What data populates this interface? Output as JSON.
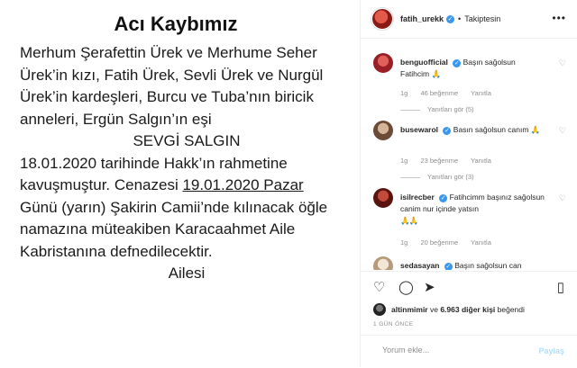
{
  "obituary": {
    "title": "Acı Kaybımız",
    "lines": [
      "Merhum Şerafettin Ürek ve Merhume Seher",
      "Ürek’in kızı, Fatih Ürek, Sevli Ürek ve Nurgül",
      "Ürek’in kardeşleri, Burcu ve Tuba’nın biricik",
      "anneleri, Ergün Salgın’ın eşi",
      "SEVGİ SALGIN",
      "18.01.2020 tarihinde Hakk’ın rahmetine",
      "kavuşmuştur. Cenazesi ",
      "19.01.2020 Pazar",
      "Günü (yarın) Şakirin Camii’nde kılınacak öğle",
      "namazına müteakiben Karacaahmet Aile",
      "Kabristanına defnedilecektir.",
      "Ailesi"
    ]
  },
  "header": {
    "username": "fatih_urekk",
    "verified": "✓",
    "separator": "•",
    "follow_status": "Takiptesin",
    "more": "•••"
  },
  "comments": [
    {
      "username": "benguofficial",
      "text": "Başın sağolsun Fatihcim",
      "emoji": "🙏",
      "time": "1g",
      "likes": "46 beğenme",
      "reply": "Yanıtla",
      "replies": "Yanıtları gör (5)"
    },
    {
      "username": "busewarol",
      "text": "Basın sağolsun canım",
      "emoji": "🙏",
      "time": "1g",
      "likes": "23 beğenme",
      "reply": "Yanıtla",
      "replies": "Yanıtları gör (3)"
    },
    {
      "username": "isilrecber",
      "text": "Fatihcimm başınız sağolsun canim nur içinde yatsın",
      "emoji": "🙏🙏",
      "time": "1g",
      "likes": "20 beğenme",
      "reply": "Yanıtla",
      "replies": ""
    },
    {
      "username": "sedasayan",
      "text": "Başın sağolsun can",
      "emoji": "",
      "time": "",
      "likes": "",
      "reply": "",
      "replies": ""
    }
  ],
  "icons": {
    "heart": "♡",
    "comment": "◯",
    "share": "➤",
    "bookmark": "▯"
  },
  "likes": {
    "user": "altinmimir",
    "connector": " ve ",
    "others": "6.963 diğer kişi",
    "suffix": " beğendi"
  },
  "timestamp": "1 GÜN ÖNCE",
  "add_comment": {
    "placeholder": "Yorum ekle...",
    "post_label": "Paylaş"
  },
  "colors": {
    "verified_blue": "#3897f0",
    "post_button_disabled": "#b2dffc",
    "muted_text": "#8e8e8e"
  }
}
